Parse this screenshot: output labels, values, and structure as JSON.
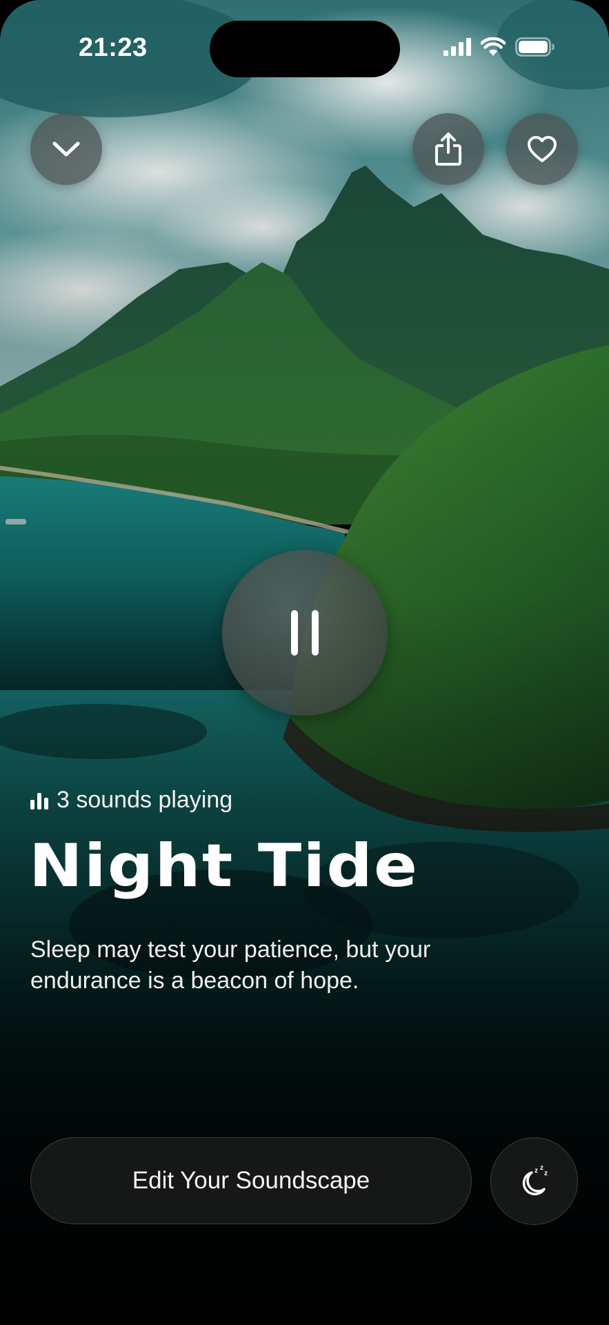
{
  "status_bar": {
    "time": "21:23"
  },
  "top_actions": {
    "collapse_icon": "chevron-down-icon",
    "share_icon": "share-icon",
    "favorite_icon": "heart-icon"
  },
  "player": {
    "state_icon": "pause-icon",
    "sounds_playing": "3 sounds playing",
    "title": "Night Tide",
    "description": "Sleep may test your patience, but your endurance is a beacon of hope."
  },
  "bottom": {
    "edit_label": "Edit Your Soundscape",
    "sleep_timer_icon": "moon-sleep-icon"
  },
  "colors": {
    "button_glass": "#4e5656",
    "bottom_button_bg": "#161818",
    "text": "#ffffff"
  }
}
